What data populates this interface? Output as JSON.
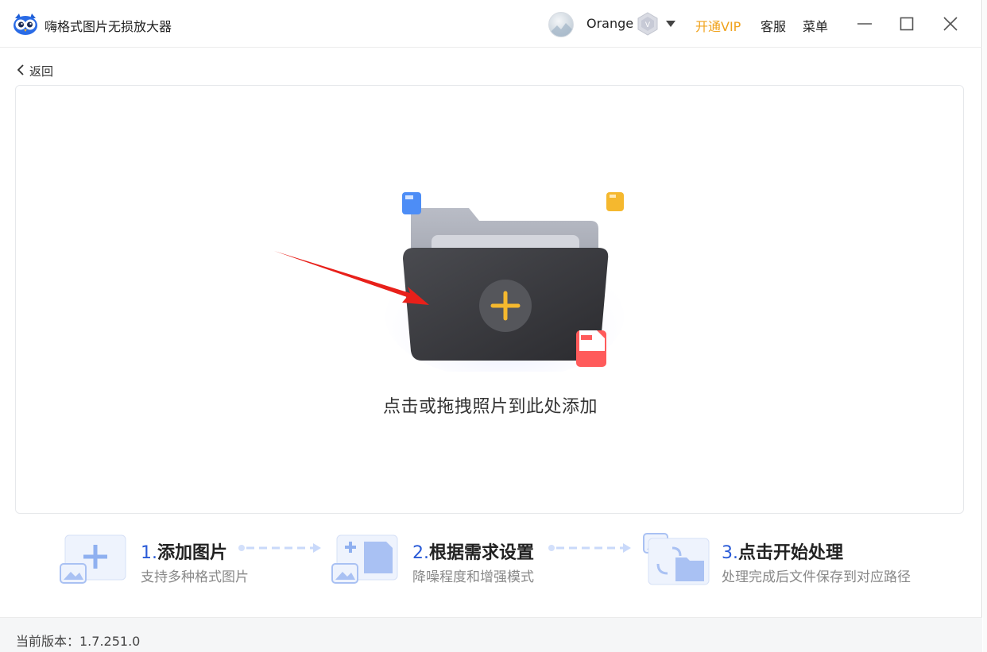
{
  "app": {
    "title": "嗨格式图片无损放大器"
  },
  "header": {
    "username": "Orange",
    "vip_link": "开通VIP",
    "service": "客服",
    "menu": "菜单"
  },
  "nav": {
    "back_label": "返回"
  },
  "dropzone": {
    "hint": "点击或拖拽照片到此处添加"
  },
  "steps": [
    {
      "num": "1.",
      "title": "添加图片",
      "desc": "支持多种格式图片"
    },
    {
      "num": "2.",
      "title": "根据需求设置",
      "desc": "降噪程度和增强模式"
    },
    {
      "num": "3.",
      "title": "点击开始处理",
      "desc": "处理完成后文件保存到对应路径"
    }
  ],
  "footer": {
    "version": "当前版本：1.7.251.0"
  },
  "colors": {
    "accent_blue": "#2a5bd7",
    "vip_orange": "#f0a21b",
    "plus_yellow": "#f5b82e",
    "arrow_red": "#e8201a"
  }
}
